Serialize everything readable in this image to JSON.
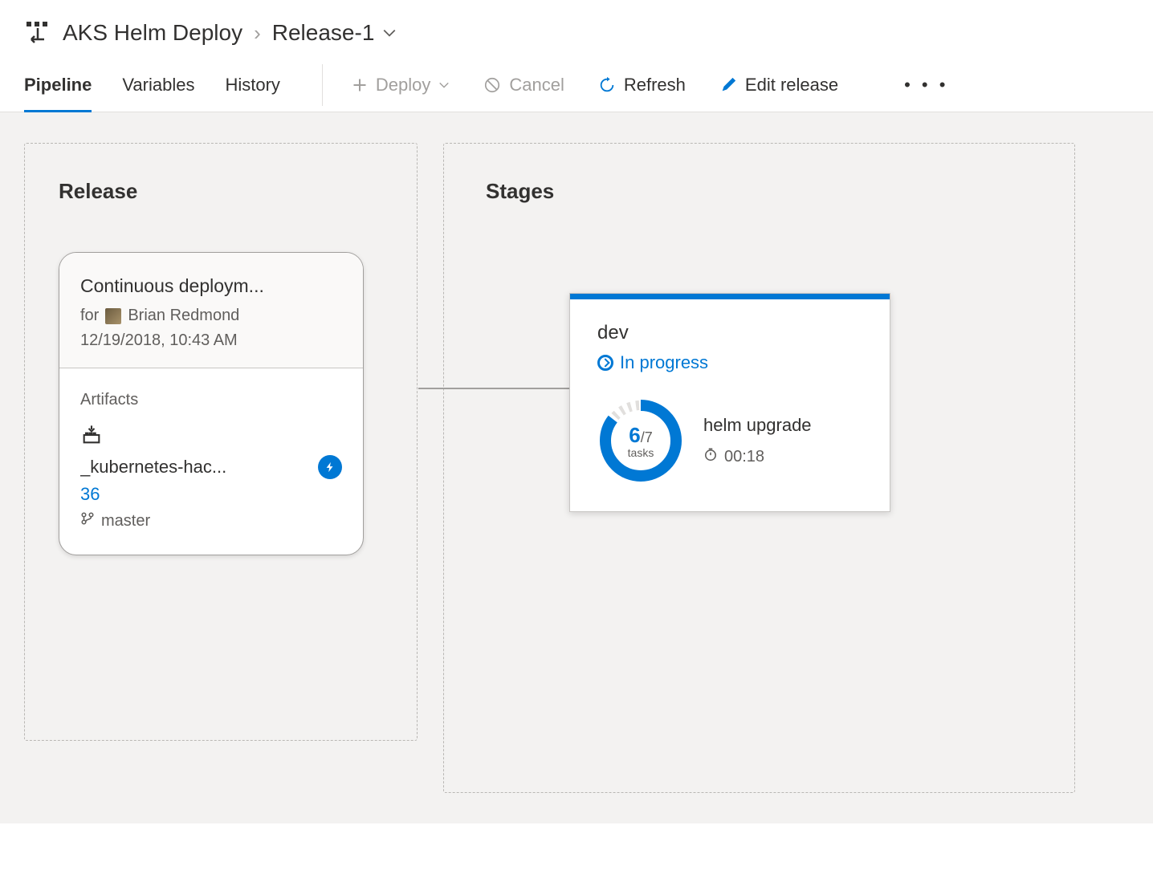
{
  "breadcrumb": {
    "pipeline_name": "AKS Helm Deploy",
    "release_name": "Release-1"
  },
  "tabs": {
    "pipeline": "Pipeline",
    "variables": "Variables",
    "history": "History"
  },
  "actions": {
    "deploy": "Deploy",
    "cancel": "Cancel",
    "refresh": "Refresh",
    "edit_release": "Edit release"
  },
  "release_panel": {
    "title": "Release",
    "card": {
      "title": "Continuous deploym...",
      "for_prefix": "for",
      "user": "Brian Redmond",
      "timestamp": "12/19/2018, 10:43 AM",
      "artifacts_label": "Artifacts",
      "artifact_name": "_kubernetes-hac...",
      "build_number": "36",
      "branch": "master"
    }
  },
  "stages_panel": {
    "title": "Stages",
    "stage": {
      "name": "dev",
      "status": "In progress",
      "tasks_done": "6",
      "tasks_total": "/7",
      "tasks_label": "tasks",
      "current_task": "helm upgrade",
      "elapsed": "00:18"
    }
  },
  "colors": {
    "accent": "#0078d4",
    "muted": "#605e5c"
  }
}
